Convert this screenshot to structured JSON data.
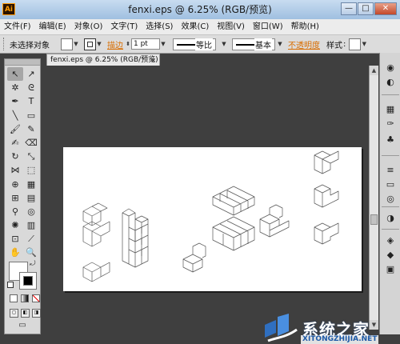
{
  "window": {
    "app_badge": "Ai",
    "title": "fenxi.eps @ 6.25% (RGB/预览)",
    "minimize": "—",
    "maximize": "□",
    "close": "✕"
  },
  "menu": [
    "文件(F)",
    "编辑(E)",
    "对象(O)",
    "文字(T)",
    "选择(S)",
    "效果(C)",
    "视图(V)",
    "窗口(W)",
    "帮助(H)"
  ],
  "control_bar": {
    "selection_status": "未选择对象",
    "stroke_label": "描边",
    "stroke_value": "1 pt",
    "profile_label": "等比",
    "brush_label": "基本",
    "opacity_label": "不透明度",
    "style_label": "样式"
  },
  "document_tab": {
    "label": "fenxi.eps @ 6.25% (RGB/预览)",
    "close": "×"
  },
  "colors": {
    "accent": "#d96d00",
    "workspace": "#3f3f3f",
    "panel": "#d9d9d9"
  },
  "tools": [
    {
      "icon": "selection-arrow-icon",
      "glyph": "↖"
    },
    {
      "icon": "direct-selection-icon",
      "glyph": "↗"
    },
    {
      "icon": "magic-wand-icon",
      "glyph": "✲"
    },
    {
      "icon": "lasso-icon",
      "glyph": "ᘓ"
    },
    {
      "icon": "pen-icon",
      "glyph": "✒"
    },
    {
      "icon": "type-icon",
      "glyph": "T"
    },
    {
      "icon": "line-segment-icon",
      "glyph": "╲"
    },
    {
      "icon": "rectangle-icon",
      "glyph": "▭"
    },
    {
      "icon": "paintbrush-icon",
      "glyph": "🖌"
    },
    {
      "icon": "pencil-icon",
      "glyph": "✎"
    },
    {
      "icon": "blob-brush-icon",
      "glyph": "✍"
    },
    {
      "icon": "eraser-icon",
      "glyph": "⌫"
    },
    {
      "icon": "rotate-icon",
      "glyph": "↻"
    },
    {
      "icon": "scale-icon",
      "glyph": "⤡"
    },
    {
      "icon": "width-icon",
      "glyph": "⋈"
    },
    {
      "icon": "free-transform-icon",
      "glyph": "⬚"
    },
    {
      "icon": "shape-builder-icon",
      "glyph": "⊕"
    },
    {
      "icon": "perspective-grid-icon",
      "glyph": "▦"
    },
    {
      "icon": "mesh-icon",
      "glyph": "⊞"
    },
    {
      "icon": "gradient-icon",
      "glyph": "▤"
    },
    {
      "icon": "eyedropper-icon",
      "glyph": "⚲"
    },
    {
      "icon": "blend-icon",
      "glyph": "◎"
    },
    {
      "icon": "symbol-sprayer-icon",
      "glyph": "✺"
    },
    {
      "icon": "column-graph-icon",
      "glyph": "▥"
    },
    {
      "icon": "artboard-icon",
      "glyph": "⊡"
    },
    {
      "icon": "slice-icon",
      "glyph": "⟋"
    },
    {
      "icon": "hand-icon",
      "glyph": "✋"
    },
    {
      "icon": "zoom-icon",
      "glyph": "🔍"
    }
  ],
  "right_panel_icons": [
    "color-icon",
    "color-guide-icon",
    "swatches-icon",
    "brushes-icon",
    "symbols-icon",
    "stroke-icon",
    "gradient-panel-icon",
    "transparency-icon",
    "appearance-icon",
    "graphic-styles-icon",
    "layers-icon",
    "artboards-icon"
  ],
  "watermark": {
    "brand": "系统之家",
    "url": "XITONGZHIJIA.NET"
  }
}
